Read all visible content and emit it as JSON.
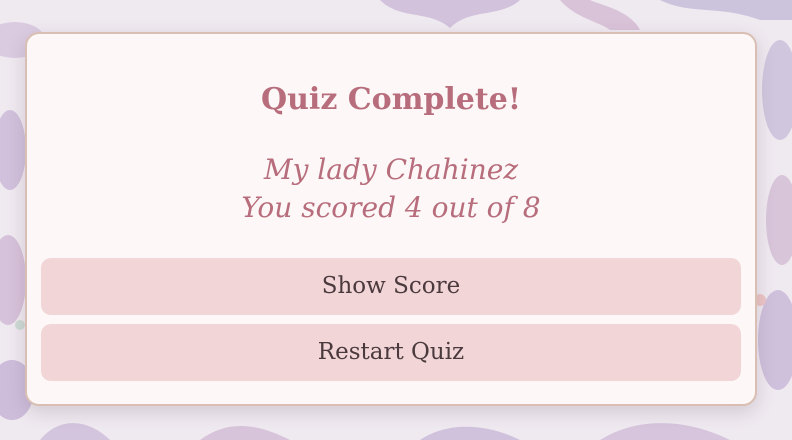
{
  "quiz": {
    "title": "Quiz Complete!",
    "greeting": "My lady Chahinez",
    "score_text": "You scored 4 out of 8",
    "score": 4,
    "total": 8
  },
  "buttons": {
    "show_score_label": "Show Score",
    "restart_label": "Restart Quiz"
  },
  "colors": {
    "accent": "#b76d7c",
    "card_bg": "#fdf8f7",
    "button_bg": "#f2d5d7",
    "button_text": "#4a3a3d",
    "card_border": "#d9bfb3"
  }
}
